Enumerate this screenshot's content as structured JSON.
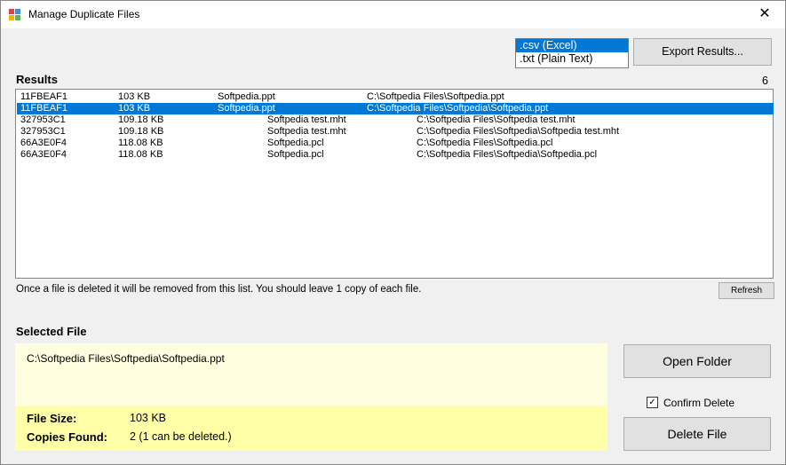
{
  "window": {
    "title": "Manage Duplicate Files",
    "close_glyph": "✕"
  },
  "export": {
    "formats": [
      {
        "label": ".csv (Excel)",
        "selected": true
      },
      {
        "label": ".txt (Plain Text)",
        "selected": false
      }
    ],
    "button_label": "Export Results..."
  },
  "results": {
    "heading": "Results",
    "count": "6",
    "rows": [
      [
        "11FBEAF1",
        "103 KB",
        "Softpedia.ppt",
        "C:\\Softpedia Files\\Softpedia.ppt"
      ],
      [
        "11FBEAF1",
        "103 KB",
        "Softpedia.ppt",
        "C:\\Softpedia Files\\Softpedia\\Softpedia.ppt"
      ],
      [
        "327953C1",
        "109.18 KB",
        "Softpedia test.mht",
        "C:\\Softpedia Files\\Softpedia test.mht"
      ],
      [
        "327953C1",
        "109.18 KB",
        "Softpedia test.mht",
        "C:\\Softpedia Files\\Softpedia\\Softpedia test.mht"
      ],
      [
        "66A3E0F4",
        "118.08 KB",
        "Softpedia.pcl",
        "C:\\Softpedia Files\\Softpedia.pcl"
      ],
      [
        "66A3E0F4",
        "118.08 KB",
        "Softpedia.pcl",
        "C:\\Softpedia Files\\Softpedia\\Softpedia.pcl"
      ]
    ],
    "selected_row": 1,
    "note": "Once a file is deleted it will be removed from this list. You should leave 1 copy of each file.",
    "refresh_label": "Refresh"
  },
  "selected_file": {
    "heading": "Selected File",
    "path": "C:\\Softpedia Files\\Softpedia\\Softpedia.ppt",
    "size_label": "File Size:",
    "size_value": "103 KB",
    "copies_label": "Copies Found:",
    "copies_value": "2 (1 can be deleted.)"
  },
  "actions": {
    "open_folder": "Open Folder",
    "confirm_delete": "Confirm Delete",
    "confirm_checked": true,
    "delete_file": "Delete File"
  },
  "colors": {
    "selection": "#0078d7",
    "panel_light": "#ffffe0",
    "panel_band": "#ffffa8"
  }
}
